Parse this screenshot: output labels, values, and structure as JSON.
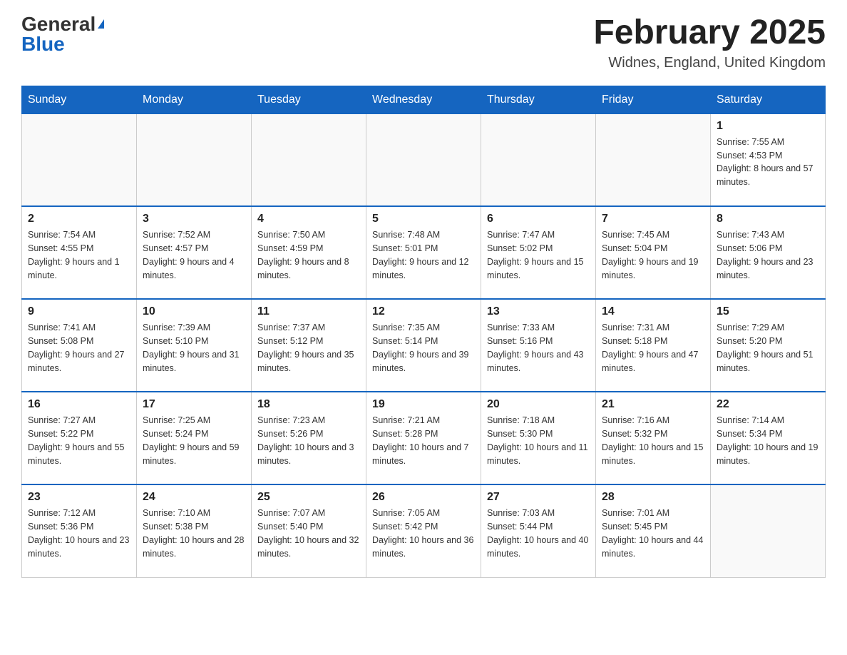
{
  "header": {
    "logo_general": "General",
    "logo_blue": "Blue",
    "month_title": "February 2025",
    "location": "Widnes, England, United Kingdom"
  },
  "days_of_week": [
    "Sunday",
    "Monday",
    "Tuesday",
    "Wednesday",
    "Thursday",
    "Friday",
    "Saturday"
  ],
  "weeks": [
    [
      {
        "day": "",
        "info": ""
      },
      {
        "day": "",
        "info": ""
      },
      {
        "day": "",
        "info": ""
      },
      {
        "day": "",
        "info": ""
      },
      {
        "day": "",
        "info": ""
      },
      {
        "day": "",
        "info": ""
      },
      {
        "day": "1",
        "info": "Sunrise: 7:55 AM\nSunset: 4:53 PM\nDaylight: 8 hours and 57 minutes."
      }
    ],
    [
      {
        "day": "2",
        "info": "Sunrise: 7:54 AM\nSunset: 4:55 PM\nDaylight: 9 hours and 1 minute."
      },
      {
        "day": "3",
        "info": "Sunrise: 7:52 AM\nSunset: 4:57 PM\nDaylight: 9 hours and 4 minutes."
      },
      {
        "day": "4",
        "info": "Sunrise: 7:50 AM\nSunset: 4:59 PM\nDaylight: 9 hours and 8 minutes."
      },
      {
        "day": "5",
        "info": "Sunrise: 7:48 AM\nSunset: 5:01 PM\nDaylight: 9 hours and 12 minutes."
      },
      {
        "day": "6",
        "info": "Sunrise: 7:47 AM\nSunset: 5:02 PM\nDaylight: 9 hours and 15 minutes."
      },
      {
        "day": "7",
        "info": "Sunrise: 7:45 AM\nSunset: 5:04 PM\nDaylight: 9 hours and 19 minutes."
      },
      {
        "day": "8",
        "info": "Sunrise: 7:43 AM\nSunset: 5:06 PM\nDaylight: 9 hours and 23 minutes."
      }
    ],
    [
      {
        "day": "9",
        "info": "Sunrise: 7:41 AM\nSunset: 5:08 PM\nDaylight: 9 hours and 27 minutes."
      },
      {
        "day": "10",
        "info": "Sunrise: 7:39 AM\nSunset: 5:10 PM\nDaylight: 9 hours and 31 minutes."
      },
      {
        "day": "11",
        "info": "Sunrise: 7:37 AM\nSunset: 5:12 PM\nDaylight: 9 hours and 35 minutes."
      },
      {
        "day": "12",
        "info": "Sunrise: 7:35 AM\nSunset: 5:14 PM\nDaylight: 9 hours and 39 minutes."
      },
      {
        "day": "13",
        "info": "Sunrise: 7:33 AM\nSunset: 5:16 PM\nDaylight: 9 hours and 43 minutes."
      },
      {
        "day": "14",
        "info": "Sunrise: 7:31 AM\nSunset: 5:18 PM\nDaylight: 9 hours and 47 minutes."
      },
      {
        "day": "15",
        "info": "Sunrise: 7:29 AM\nSunset: 5:20 PM\nDaylight: 9 hours and 51 minutes."
      }
    ],
    [
      {
        "day": "16",
        "info": "Sunrise: 7:27 AM\nSunset: 5:22 PM\nDaylight: 9 hours and 55 minutes."
      },
      {
        "day": "17",
        "info": "Sunrise: 7:25 AM\nSunset: 5:24 PM\nDaylight: 9 hours and 59 minutes."
      },
      {
        "day": "18",
        "info": "Sunrise: 7:23 AM\nSunset: 5:26 PM\nDaylight: 10 hours and 3 minutes."
      },
      {
        "day": "19",
        "info": "Sunrise: 7:21 AM\nSunset: 5:28 PM\nDaylight: 10 hours and 7 minutes."
      },
      {
        "day": "20",
        "info": "Sunrise: 7:18 AM\nSunset: 5:30 PM\nDaylight: 10 hours and 11 minutes."
      },
      {
        "day": "21",
        "info": "Sunrise: 7:16 AM\nSunset: 5:32 PM\nDaylight: 10 hours and 15 minutes."
      },
      {
        "day": "22",
        "info": "Sunrise: 7:14 AM\nSunset: 5:34 PM\nDaylight: 10 hours and 19 minutes."
      }
    ],
    [
      {
        "day": "23",
        "info": "Sunrise: 7:12 AM\nSunset: 5:36 PM\nDaylight: 10 hours and 23 minutes."
      },
      {
        "day": "24",
        "info": "Sunrise: 7:10 AM\nSunset: 5:38 PM\nDaylight: 10 hours and 28 minutes."
      },
      {
        "day": "25",
        "info": "Sunrise: 7:07 AM\nSunset: 5:40 PM\nDaylight: 10 hours and 32 minutes."
      },
      {
        "day": "26",
        "info": "Sunrise: 7:05 AM\nSunset: 5:42 PM\nDaylight: 10 hours and 36 minutes."
      },
      {
        "day": "27",
        "info": "Sunrise: 7:03 AM\nSunset: 5:44 PM\nDaylight: 10 hours and 40 minutes."
      },
      {
        "day": "28",
        "info": "Sunrise: 7:01 AM\nSunset: 5:45 PM\nDaylight: 10 hours and 44 minutes."
      },
      {
        "day": "",
        "info": ""
      }
    ]
  ]
}
